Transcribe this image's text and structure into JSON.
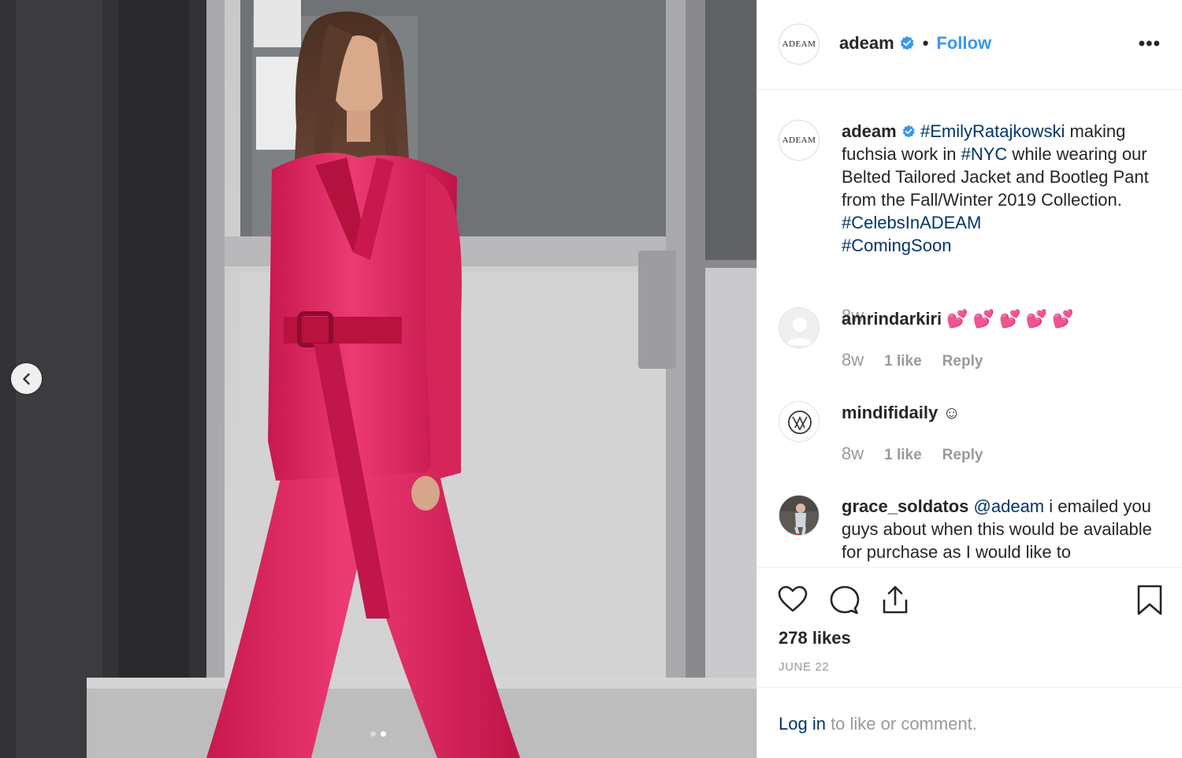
{
  "post": {
    "username": "adeam",
    "avatar_text": "ADEAM",
    "follow_label": "Follow",
    "separator": "•",
    "more_label": "•••"
  },
  "caption": {
    "username": "adeam",
    "tag1": "#EmilyRatajkowski",
    "text1": " making fuchsia work in ",
    "tag2": "#NYC",
    "text2": " while wearing our Belted Tailored Jacket and Bootleg Pant from the Fall/Winter 2019 Collection. ",
    "tag3": "#CelebsInADEAM",
    "tag4": "#ComingSoon",
    "time": "8w"
  },
  "comments": [
    {
      "username": "amrindarkiri",
      "text": "💕 💕 💕 💕 💕",
      "time": "8w",
      "likes": "1 like",
      "reply": "Reply"
    },
    {
      "username": "mindifidaily",
      "text": "☺",
      "time": "8w",
      "likes": "1 like",
      "reply": "Reply"
    },
    {
      "username": "grace_soldatos",
      "mention": "@adeam",
      "text": " i emailed you guys about when this would be available for purchase as I would like to"
    }
  ],
  "stats": {
    "likes": "278 likes",
    "date": "JUNE 22"
  },
  "footer": {
    "login_link": "Log in",
    "login_text": " to like or comment."
  },
  "icons": [
    "chevron-left-icon",
    "verified-icon",
    "heart-icon",
    "comment-icon",
    "share-icon",
    "bookmark-icon",
    "default-avatar-icon"
  ],
  "colors": {
    "accent": "#3897f0",
    "hashtag": "#003569",
    "muted": "#999999",
    "suit": "#e0245e"
  }
}
